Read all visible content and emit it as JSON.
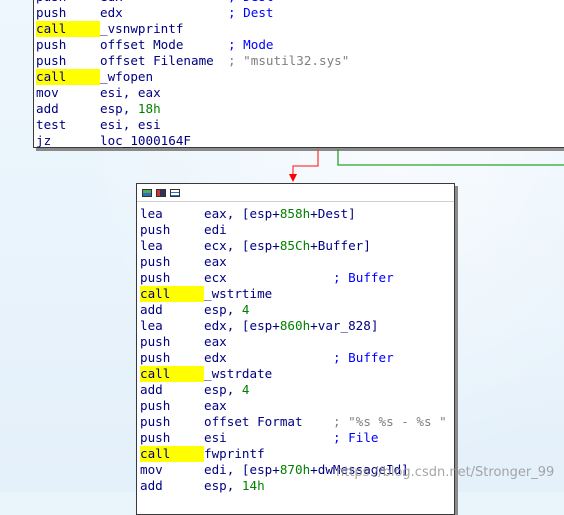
{
  "top_block": {
    "lines": [
      {
        "mn": "push",
        "op": "edx",
        "comment": "; Dest",
        "comment_type": "cmt"
      },
      {
        "mn": "push",
        "op": "edx",
        "comment": "; Dest",
        "comment_type": "cmt"
      },
      {
        "mn": "call",
        "op": "_vsnwprintf",
        "comment": "",
        "comment_type": "cmt",
        "is_call": true
      },
      {
        "mn": "push",
        "op": "offset Mode",
        "comment": "; Mode",
        "comment_type": "cmt"
      },
      {
        "mn": "push",
        "op": "offset Filename",
        "comment": "; \"msutil32.sys\"",
        "comment_type": "cstr"
      },
      {
        "mn": "call",
        "op": "_wfopen",
        "comment": "",
        "comment_type": "cmt",
        "is_call": true
      },
      {
        "mn": "mov",
        "op": "esi, eax",
        "comment": "",
        "comment_type": "cmt"
      },
      {
        "mn": "add",
        "op": "esp, ",
        "num": "18h",
        "comment": "",
        "comment_type": "cmt"
      },
      {
        "mn": "test",
        "op": "esi, esi",
        "comment": "",
        "comment_type": "cmt"
      },
      {
        "mn": "jz",
        "op": "loc_1000164F",
        "comment": "",
        "comment_type": "cmt"
      }
    ]
  },
  "main_block": {
    "lines": [
      {
        "mn": "lea",
        "op": "eax, [esp+",
        "num": "858h",
        "op2": "+Dest]",
        "comment": ""
      },
      {
        "mn": "push",
        "op": "edi",
        "comment": ""
      },
      {
        "mn": "lea",
        "op": "ecx, [esp+",
        "num": "85Ch",
        "op2": "+Buffer]",
        "comment": ""
      },
      {
        "mn": "push",
        "op": "eax",
        "comment": ""
      },
      {
        "mn": "push",
        "op": "ecx",
        "comment": "; Buffer",
        "comment_type": "cmt"
      },
      {
        "mn": "call",
        "op": "_wstrtime",
        "comment": "",
        "is_call": true
      },
      {
        "mn": "add",
        "op": "esp, ",
        "num": "4",
        "comment": ""
      },
      {
        "mn": "lea",
        "op": "edx, [esp+",
        "num": "860h",
        "op2": "+var_828]",
        "comment": ""
      },
      {
        "mn": "push",
        "op": "eax",
        "comment": ""
      },
      {
        "mn": "push",
        "op": "edx",
        "comment": "; Buffer",
        "comment_type": "cmt"
      },
      {
        "mn": "call",
        "op": "_wstrdate",
        "comment": "",
        "is_call": true
      },
      {
        "mn": "add",
        "op": "esp, ",
        "num": "4",
        "comment": ""
      },
      {
        "mn": "push",
        "op": "eax",
        "comment": ""
      },
      {
        "mn": "push",
        "op": "offset Format",
        "comment": "; \"%s %s - %s \"",
        "comment_type": "cstr"
      },
      {
        "mn": "push",
        "op": "esi",
        "comment": "; File",
        "comment_type": "cmt"
      },
      {
        "mn": "call",
        "op": "fwprintf",
        "comment": "",
        "is_call": true
      },
      {
        "mn": "mov",
        "op": "edi, [esp+",
        "num": "870h",
        "op2": "+dwMessageId]",
        "comment": ""
      },
      {
        "mn": "add",
        "op": "esp, ",
        "num": "14h",
        "comment": ""
      }
    ]
  },
  "colors": {
    "background": "#eaf4fb",
    "mnemonic": "#000080",
    "number": "#008000",
    "comment": "#0000ff",
    "string_comment": "#7f7f7f",
    "call_highlight": "#ffff00",
    "edge_true": "#008000",
    "edge_false": "#ff0000"
  },
  "watermark": "https://blog.csdn.net/Stronger_99"
}
